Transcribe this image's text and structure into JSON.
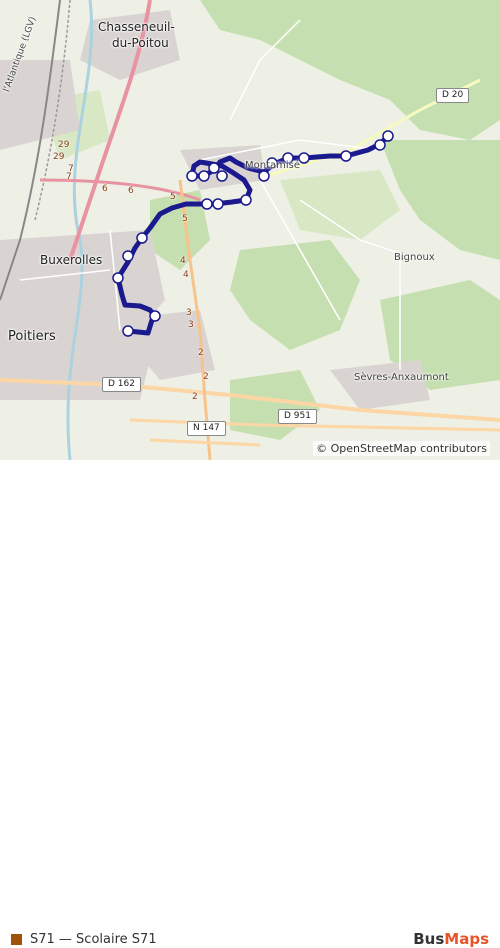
{
  "map": {
    "places": {
      "chasseneuil": "Chasseneuil-",
      "du_poitou": "du-Poitou",
      "buxerolles": "Buxerolles",
      "poitiers": "Poitiers",
      "montamise": "Montamisé",
      "bignoux": "Bignoux",
      "sevres": "Sèvres-Anxaumont",
      "atlantique": "l'Atlantique (LGV)"
    },
    "roads": {
      "d20": "D 20",
      "d162": "D 162",
      "d951": "D 951",
      "n147": "N 147",
      "km_labels": [
        "29",
        "29",
        "7",
        "6",
        "6",
        "5",
        "5",
        "4",
        "4",
        "3",
        "3",
        "2",
        "2",
        "2",
        "7"
      ]
    },
    "route": {
      "color": "#1a1a8e",
      "stop_color": "#ffffff"
    },
    "attribution": "© OpenStreetMap contributors"
  },
  "legend": {
    "swatch_color": "#a0520a",
    "label": "S71 — Scolaire S71"
  },
  "brand": {
    "part1": "Bus",
    "part2": "Maps"
  }
}
